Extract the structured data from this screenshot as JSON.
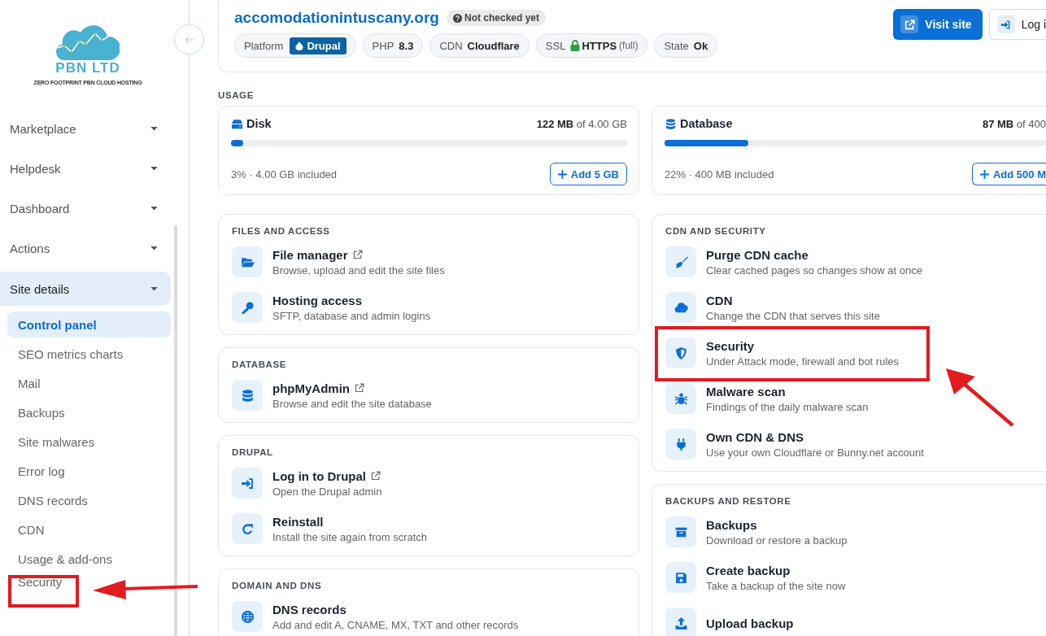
{
  "sidebar": {
    "logo": {
      "name": "PBN LTD",
      "tagline": "ZERO FOOTPRINT PBN CLOUD HOSTING"
    },
    "menu": [
      {
        "label": "Marketplace",
        "selected": false
      },
      {
        "label": "Helpdesk",
        "selected": false
      },
      {
        "label": "Dashboard",
        "selected": false
      },
      {
        "label": "Actions",
        "selected": false
      },
      {
        "label": "Site details",
        "selected": true,
        "children": [
          {
            "label": "Control panel",
            "selected": true,
            "highlighted": false
          },
          {
            "label": "SEO metrics charts",
            "selected": false,
            "highlighted": false
          },
          {
            "label": "Mail",
            "selected": false,
            "highlighted": false
          },
          {
            "label": "Backups",
            "selected": false,
            "highlighted": false
          },
          {
            "label": "Site malwares",
            "selected": false,
            "highlighted": false
          },
          {
            "label": "Error log",
            "selected": false,
            "highlighted": false
          },
          {
            "label": "DNS records",
            "selected": false,
            "highlighted": false
          },
          {
            "label": "CDN",
            "selected": false,
            "highlighted": false
          },
          {
            "label": "Usage & add-ons",
            "selected": false,
            "highlighted": false
          },
          {
            "label": "Security",
            "selected": false,
            "highlighted": true
          }
        ]
      }
    ]
  },
  "header": {
    "domain": "accomodationintuscany.org",
    "check_badge": "Not checked yet",
    "chips": [
      {
        "label": "Platform",
        "value": "Drupal",
        "kind": "badge"
      },
      {
        "label": "PHP",
        "value": "8.3",
        "kind": "plain"
      },
      {
        "label": "CDN",
        "value": "Cloudflare",
        "kind": "plain"
      },
      {
        "label": "SSL",
        "value": "HTTPS",
        "note": "(full)",
        "kind": "lock"
      },
      {
        "label": "State",
        "value": "Ok",
        "kind": "plain"
      }
    ],
    "buttons": [
      {
        "label": "Visit site",
        "kind": "primary"
      },
      {
        "label": "Log i",
        "kind": "outline"
      }
    ]
  },
  "usage": {
    "title": "USAGE",
    "items": [
      {
        "name": "Disk",
        "kind": "disk",
        "amount": "**122 MB** of 4.00 GB",
        "level": 0.03,
        "summary": "3% · 4.00 GB included",
        "action": "Add 5 GB"
      },
      {
        "name": "Database",
        "kind": "database",
        "amount": "**87 MB** of 400",
        "level": 0.22,
        "summary": "22% · 400 MB included",
        "action": "Add 500 M"
      }
    ]
  },
  "columns": [
    {
      "cards": [
        {
          "title": "FILES AND ACCESS",
          "items": [
            {
              "title": "File manager",
              "description": "Browse, upload and edit the site files",
              "kind": "folder",
              "external": true,
              "highlighted": false
            },
            {
              "title": "Hosting access",
              "description": "SFTP, database and admin logins",
              "kind": "key",
              "external": false,
              "highlighted": false
            }
          ]
        },
        {
          "title": "DATABASE",
          "items": [
            {
              "title": "phpMyAdmin",
              "description": "Browse and edit the site database",
              "kind": "database",
              "external": true,
              "highlighted": false
            }
          ]
        },
        {
          "title": "DRUPAL",
          "items": [
            {
              "title": "Log in to Drupal",
              "description": "Open the Drupal admin",
              "kind": "signin",
              "external": true,
              "highlighted": false
            },
            {
              "title": "Reinstall",
              "description": "Install the site again from scratch",
              "kind": "redo",
              "external": false,
              "highlighted": false
            }
          ]
        },
        {
          "title": "DOMAIN AND DNS",
          "items": [
            {
              "title": "DNS records",
              "description": "Add and edit A, CNAME, MX, TXT and other records",
              "kind": "globe",
              "external": false,
              "highlighted": false
            }
          ]
        }
      ]
    },
    {
      "cards": [
        {
          "title": "CDN AND SECURITY",
          "items": [
            {
              "title": "Purge CDN cache",
              "description": "Clear cached pages so changes show at once",
              "kind": "broom",
              "external": false,
              "highlighted": false
            },
            {
              "title": "CDN",
              "description": "Change the CDN that serves this site",
              "kind": "cloud",
              "external": false,
              "highlighted": false
            },
            {
              "title": "Security",
              "description": "Under Attack mode, firewall and bot rules",
              "kind": "shield",
              "external": false,
              "highlighted": true
            },
            {
              "title": "Malware scan",
              "description": "Findings of the daily malware scan",
              "kind": "bug",
              "external": false,
              "highlighted": false
            },
            {
              "title": "Own CDN & DNS",
              "description": "Use your own Cloudflare or Bunny.net account",
              "kind": "plug",
              "external": false,
              "highlighted": false
            }
          ]
        },
        {
          "title": "BACKUPS AND RESTORE",
          "items": [
            {
              "title": "Backups",
              "description": "Download or restore a backup",
              "kind": "archive",
              "external": false,
              "highlighted": false
            },
            {
              "title": "Create backup",
              "description": "Take a backup of the site now",
              "kind": "floppy",
              "external": false,
              "highlighted": false
            },
            {
              "title": "Upload backup",
              "kind": "upload",
              "external": false,
              "highlighted": false
            }
          ]
        }
      ]
    }
  ]
}
